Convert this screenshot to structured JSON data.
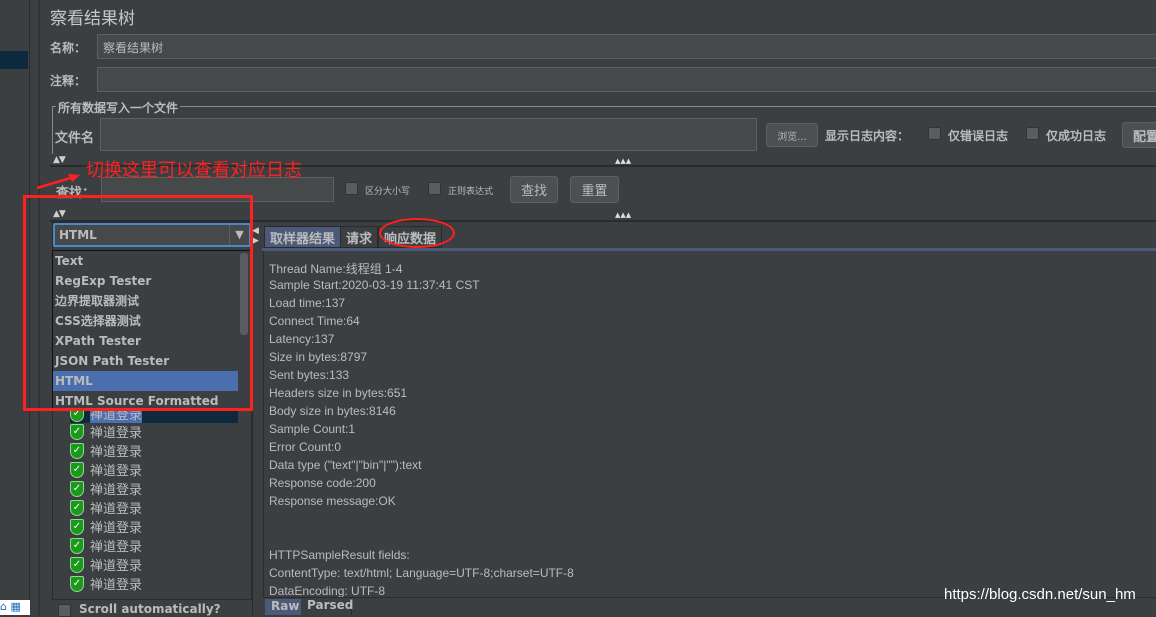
{
  "window": {
    "title": "察看结果树"
  },
  "form": {
    "name_label": "名称：",
    "name_value": "察看结果树",
    "comment_label": "注释：",
    "comment_value": "",
    "file_group_label": "所有数据写入一个文件",
    "filename_label": "文件名",
    "filename_value": "",
    "browse_label": "浏览...",
    "log_display_label": "显示日志内容：",
    "errors_only_label": "仅错误日志",
    "success_only_label": "仅成功日志",
    "config_label": "配置"
  },
  "search": {
    "label": "查找：",
    "value": "",
    "case_label": "区分大小写",
    "regex_label": "正则表达式",
    "find_label": "查找",
    "reset_label": "重置"
  },
  "renderer": {
    "selected": "HTML",
    "options": [
      "Text",
      "RegExp Tester",
      "边界提取器测试",
      "CSS选择器测试",
      "XPath Tester",
      "JSON Path Tester",
      "HTML",
      "HTML Source Formatted"
    ]
  },
  "tree": {
    "items": [
      "禅道登录",
      "禅道登录",
      "禅道登录",
      "禅道登录",
      "禅道登录",
      "禅道登录",
      "禅道登录",
      "禅道登录",
      "禅道登录",
      "禅道登录"
    ],
    "scroll_label": "Scroll automatically?"
  },
  "tabs": [
    "取样器结果",
    "请求",
    "响应数据"
  ],
  "result_lines": [
    "Thread Name:线程组 1-4",
    "Sample Start:2020-03-19 11:37:41 CST",
    "Load time:137",
    "Connect Time:64",
    "Latency:137",
    "Size in bytes:8797",
    "Sent bytes:133",
    "Headers size in bytes:651",
    "Body size in bytes:8146",
    "Sample Count:1",
    "Error Count:0",
    "Data type (\"text\"|\"bin\"|\"\"):text",
    "Response code:200",
    "Response message:OK",
    "",
    "",
    "HTTPSampleResult fields:",
    "ContentType: text/html; Language=UTF-8;charset=UTF-8",
    "DataEncoding: UTF-8"
  ],
  "bottom_tabs": [
    "Raw",
    "Parsed"
  ],
  "annotation": {
    "text": "切换这里可以查看对应日志",
    "color": "#ff2020"
  },
  "watermark": "https://blog.csdn.net/sun_hm"
}
